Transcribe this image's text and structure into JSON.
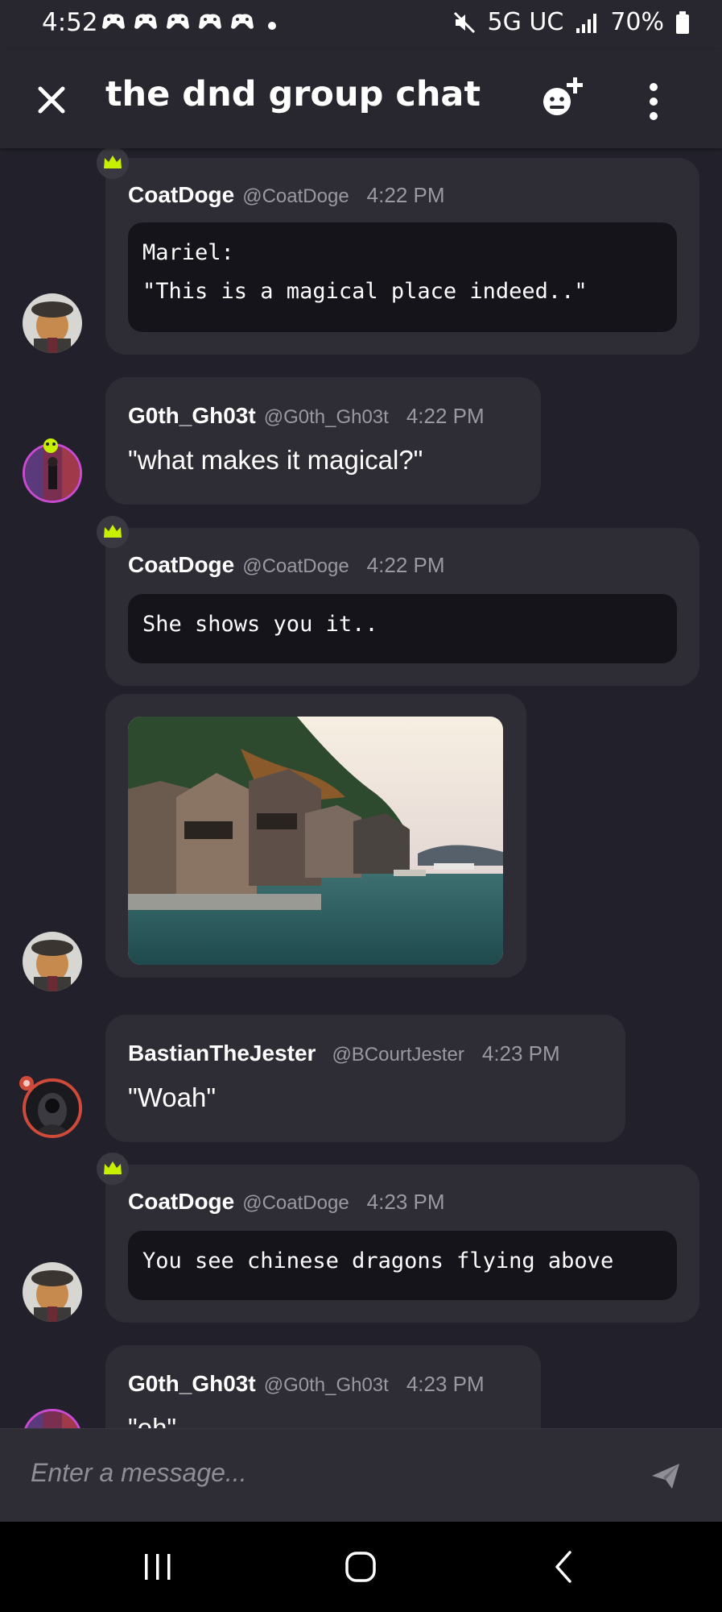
{
  "status_bar": {
    "time": "4:52",
    "network": "5G UC",
    "battery": "70%"
  },
  "app_bar": {
    "title": "the dnd group chat"
  },
  "messages": [
    {
      "user": "CoatDoge",
      "handle": "@CoatDoge",
      "time": "4:22 PM",
      "lines": [
        "Mariel:",
        "\"This is a magical place indeed..\""
      ]
    },
    {
      "user": "G0th_Gh03t",
      "handle": "@G0th_Gh03t",
      "time": "4:22 PM",
      "text": "\"what makes it magical?\""
    },
    {
      "user": "CoatDoge",
      "handle": "@CoatDoge",
      "time": "4:22 PM",
      "lines": [
        "She shows you it.."
      ]
    },
    {
      "image": "waterfront-houses-photo"
    },
    {
      "user": "BastianTheJester",
      "handle": "@BCourtJester",
      "time": "4:23 PM",
      "text": "\"Woah\""
    },
    {
      "user": "CoatDoge",
      "handle": "@CoatDoge",
      "time": "4:23 PM",
      "lines": [
        "You see chinese dragons flying above"
      ]
    },
    {
      "user": "G0th_Gh03t",
      "handle": "@G0th_Gh03t",
      "time": "4:23 PM",
      "text": "\"oh\""
    }
  ],
  "composer": {
    "placeholder": "Enter a message..."
  },
  "icons": [
    "close-icon",
    "add-member-icon",
    "more-icon",
    "crown-icon",
    "send-icon"
  ],
  "colors": {
    "crown": "#c6f000",
    "background": "#22212b",
    "card": "#2e2d35",
    "code": "#15141a"
  }
}
